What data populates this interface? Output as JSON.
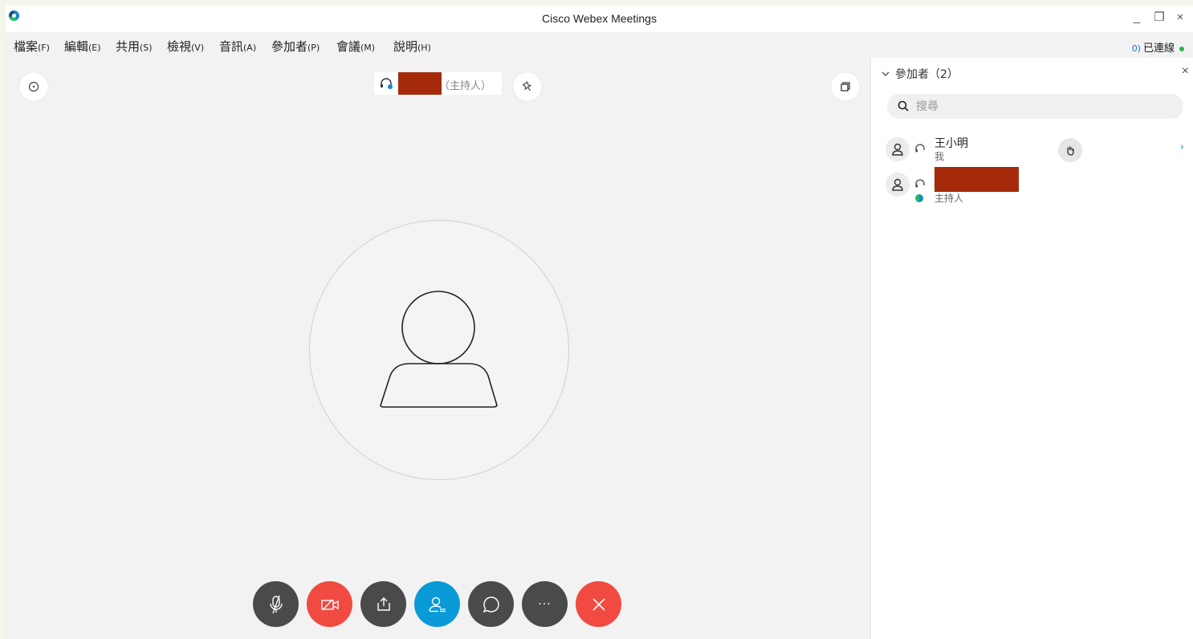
{
  "window": {
    "title": "Cisco Webex Meetings",
    "minimize": "_",
    "maximize": "❐",
    "close": "×"
  },
  "menu": [
    {
      "label": "檔案",
      "key": "(F)"
    },
    {
      "label": "編輯",
      "key": "(E)"
    },
    {
      "label": "共用",
      "key": "(S)"
    },
    {
      "label": "檢視",
      "key": "(V)"
    },
    {
      "label": "音訊",
      "key": "(A)"
    },
    {
      "label": "參加者",
      "key": "(P)"
    },
    {
      "label": "會議",
      "key": "(M)"
    },
    {
      "label": "說明",
      "key": "(H)"
    }
  ],
  "status": {
    "connected": "已連線",
    "status_color": "#28b44a"
  },
  "stage": {
    "speaker_role": "（主持人）"
  },
  "controls": {
    "more": "···"
  },
  "panel": {
    "title": "參加者（2）",
    "close": "×",
    "search_placeholder": "搜尋",
    "participants": [
      {
        "name": "王小明",
        "role": "我",
        "raised_hand": true
      },
      {
        "name": "",
        "role": "主持人",
        "raised_hand": false
      }
    ]
  },
  "colors": {
    "accent": "#0a9ad8",
    "danger": "#f04a41",
    "dark_button": "#4a4a4a",
    "redaction": "#a52a0c"
  }
}
